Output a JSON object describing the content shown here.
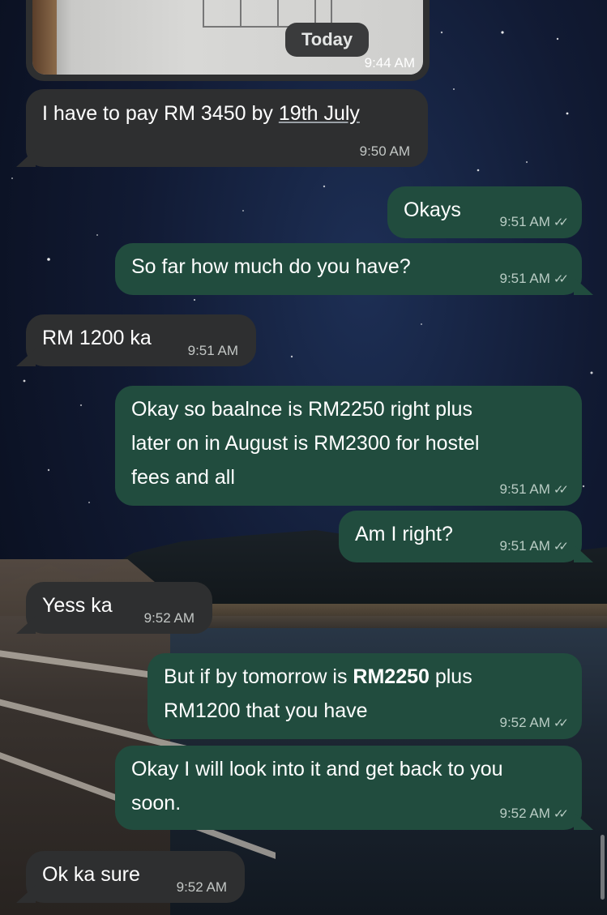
{
  "header": {
    "date_chip": "Today",
    "image_time": "9:44 AM"
  },
  "messages": [
    {
      "dir": "in",
      "text_before": "I have to pay RM 3450 by ",
      "link": "19th July",
      "time": "9:50 AM"
    },
    {
      "dir": "out",
      "text": "Okays",
      "time": "9:51 AM"
    },
    {
      "dir": "out",
      "text": "So far how much do you have?",
      "time": "9:51 AM"
    },
    {
      "dir": "in",
      "text": "RM 1200 ka",
      "time": "9:51 AM"
    },
    {
      "dir": "out",
      "text": "Okay so baalnce is RM2250 right plus later on in August is RM2300 for hostel fees and all",
      "line1": "Okay so baalnce is RM2250 right plus",
      "line2": "later on in August is RM2300 for hostel",
      "line3": "fees and all",
      "time": "9:51 AM"
    },
    {
      "dir": "out",
      "text": "Am I right?",
      "time": "9:51 AM"
    },
    {
      "dir": "in",
      "text": "Yess ka",
      "time": "9:52 AM"
    },
    {
      "dir": "out",
      "text_before": "But if by tomorrow is ",
      "bold": "RM2250",
      "text_after": " plus",
      "line2": "RM1200 that you have",
      "time": "9:52 AM"
    },
    {
      "dir": "out",
      "line1": "Okay I will look into it and get back to you",
      "line2": "soon.",
      "time": "9:52 AM"
    },
    {
      "dir": "in",
      "text": "Ok ka sure",
      "time": "9:52 AM"
    }
  ],
  "icons": {
    "read_receipt": "double-check-icon"
  },
  "colors": {
    "incoming_bubble": "#2e2f30",
    "outgoing_bubble": "#214c3e",
    "text": "#ffffff"
  }
}
